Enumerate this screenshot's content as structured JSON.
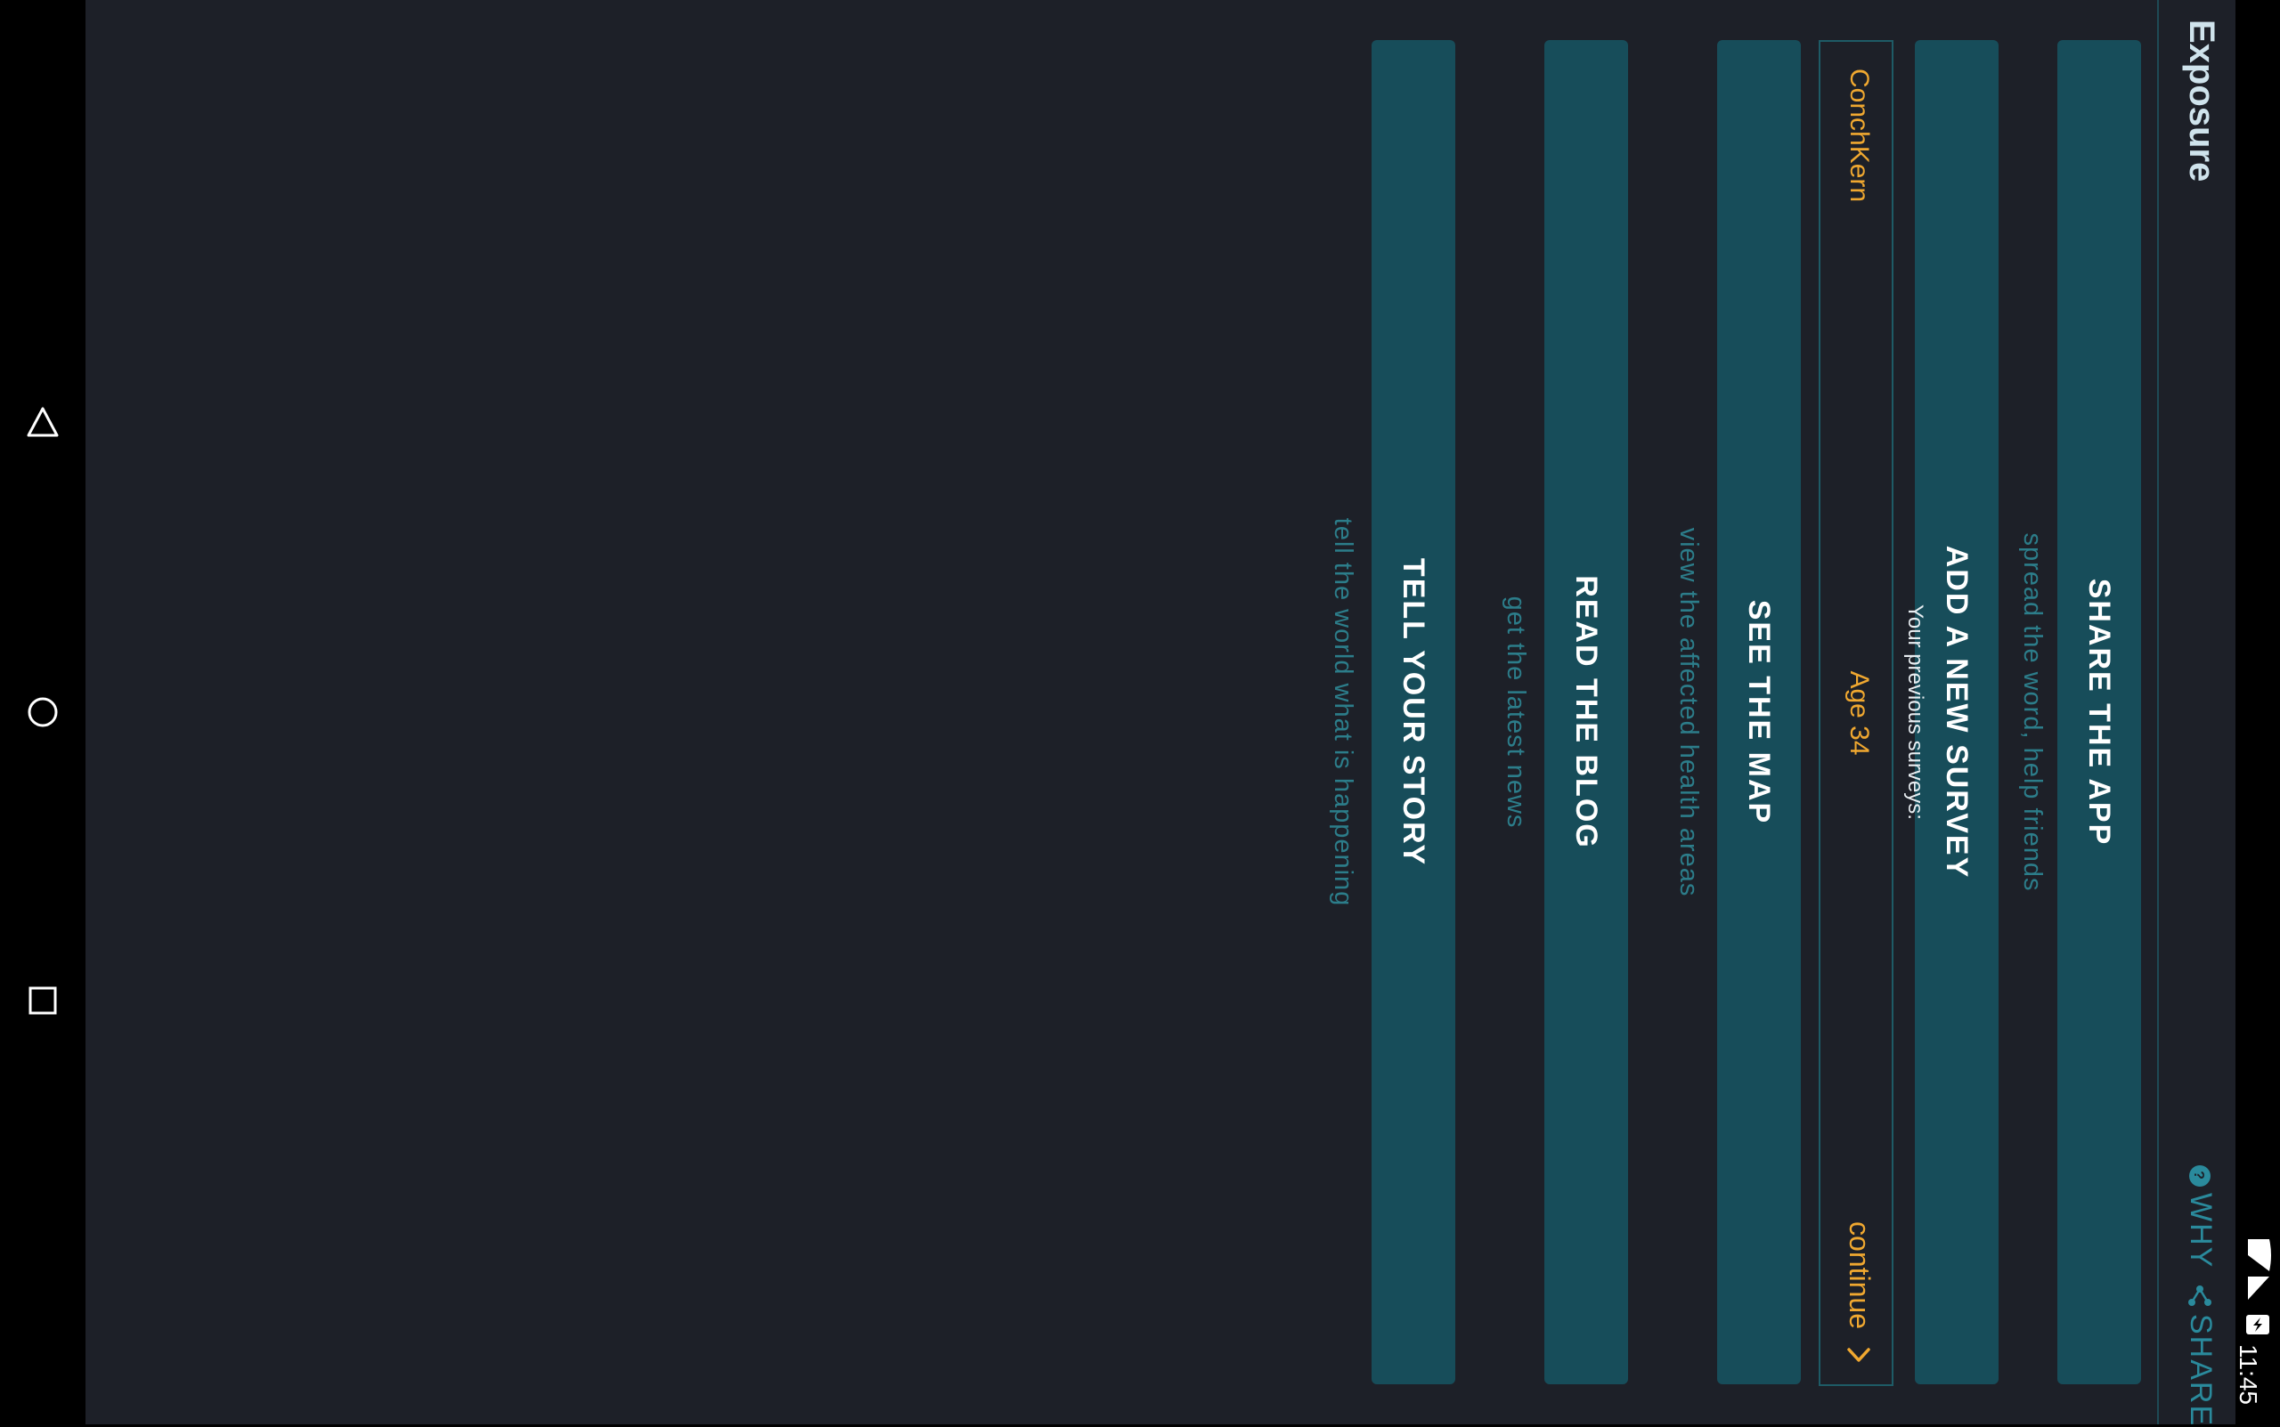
{
  "status": {
    "time": "11:45",
    "icons": [
      "wifi-icon",
      "cell-signal-icon",
      "battery-charging-icon"
    ]
  },
  "navigation": {
    "buttons": [
      "back-icon",
      "home-icon",
      "recents-icon"
    ]
  },
  "toolbar": {
    "title": "Exposure",
    "why_label": "WHY",
    "share_label": "SHARE"
  },
  "main": {
    "share_app": {
      "label": "SHARE THE APP",
      "caption": "spread the word, help friends"
    },
    "add_survey": {
      "label": "ADD A NEW SURVEY"
    },
    "previous_surveys": {
      "heading": "Your previous surveys:",
      "items": [
        {
          "name": "ConchKern",
          "age": "Age 34",
          "action": "continue"
        }
      ]
    },
    "see_map": {
      "label": "SEE THE MAP",
      "caption": "view the affected health areas"
    },
    "read_blog": {
      "label": "READ THE BLOG",
      "caption": "get the latest news"
    },
    "tell_story": {
      "label": "TELL YOUR STORY",
      "caption": "tell the world what is happening"
    }
  },
  "colors": {
    "background": "#1d2028",
    "button": "#174d5a",
    "accent": "#2a8a9c",
    "highlight": "#f0a830"
  }
}
